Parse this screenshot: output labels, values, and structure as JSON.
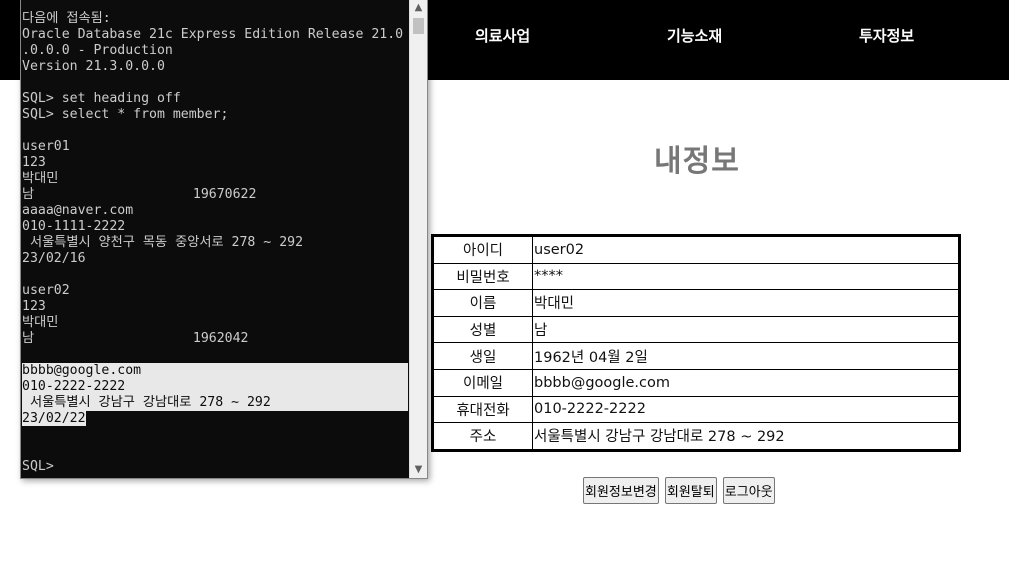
{
  "nav": {
    "items": [
      "의료사업",
      "기능소재",
      "투자정보"
    ]
  },
  "page": {
    "title": "내정보"
  },
  "member_info": {
    "rows": [
      {
        "label": "아이디",
        "value": "user02"
      },
      {
        "label": "비밀번호",
        "value": "****"
      },
      {
        "label": "이름",
        "value": "박대민"
      },
      {
        "label": "성별",
        "value": "남"
      },
      {
        "label": "생일",
        "value": "1962년 04월 2일"
      },
      {
        "label": "이메일",
        "value": "bbbb@google.com"
      },
      {
        "label": "휴대전화",
        "value": "010-2222-2222"
      },
      {
        "label": "주소",
        "value": "서울특별시 강남구 강남대로 278 ~ 292"
      }
    ]
  },
  "buttons": {
    "edit": "회원정보변경",
    "withdraw": "회원탈퇴",
    "logout": "로그아웃"
  },
  "terminal": {
    "lines": [
      "다음에 접속됨:",
      "Oracle Database 21c Express Edition Release 21.0",
      ".0.0.0 - Production",
      "Version 21.3.0.0.0",
      "",
      "SQL> set heading off",
      "SQL> select * from member;",
      "",
      "user01",
      "123",
      "박대민",
      "남                    19670622",
      "aaaa@naver.com",
      "010-1111-2222",
      " 서울특별시 양천구 목동 중앙서로 278 ~ 292",
      "23/02/16",
      "",
      "user02",
      "123",
      "박대민",
      "남                    1962042",
      "",
      "bbbb@google.com",
      "010-2222-2222",
      " 서울특별시 강남구 강남대로 278 ~ 292",
      "23/02/22",
      "",
      "",
      "SQL>"
    ],
    "scroll_up_icon": "▲",
    "scroll_down_icon": "▼"
  }
}
